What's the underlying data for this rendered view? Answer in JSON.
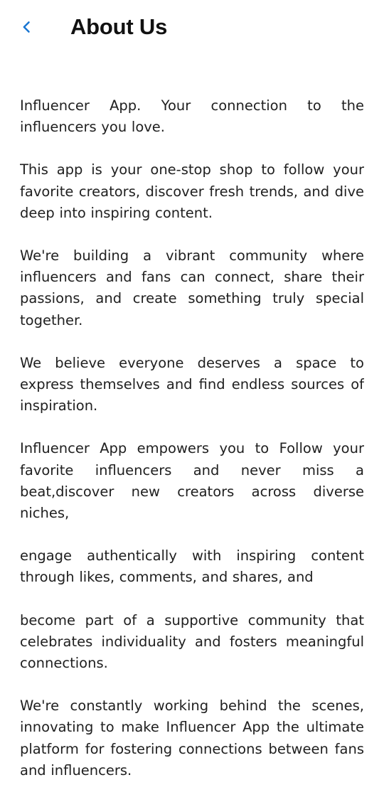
{
  "header": {
    "back_icon": "chevron-left-icon",
    "title": "About Us"
  },
  "colors": {
    "accent": "#1976d2",
    "background": "#ffffff",
    "text": "#202020"
  },
  "content": {
    "paragraphs": [
      "Influencer App. Your connection to the influencers you love.",
      "This app is your one-stop shop to follow your favorite creators, discover fresh trends, and dive deep into inspiring content.",
      "We're building a vibrant community where influencers and fans can connect, share their passions, and create something truly special together.",
      "We believe everyone deserves a space to express themselves and find endless sources of inspiration.",
      "Influencer App empowers you to Follow your favorite influencers and never miss a beat,discover new creators across diverse niches,",
      "engage authentically with inspiring content through likes, comments, and shares, and",
      "become part of a supportive community that celebrates individuality and fosters meaningful connections.",
      "We're constantly working behind the scenes, innovating to make Influencer App the ultimate platform for fostering connections between fans and influencers."
    ]
  }
}
